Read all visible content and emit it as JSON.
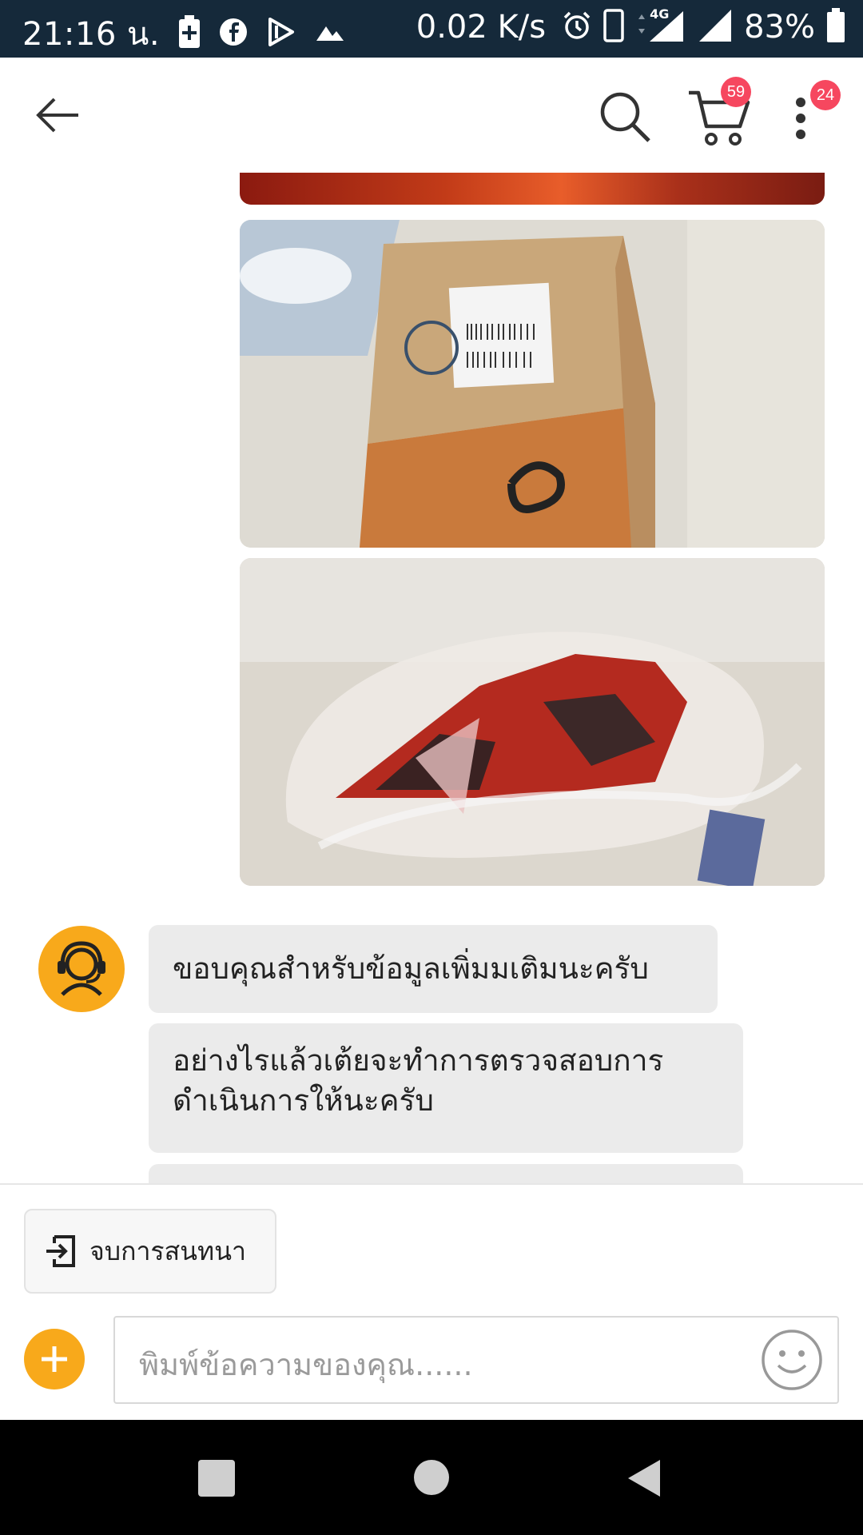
{
  "status_bar": {
    "time": "21:16 น.",
    "speed": "0.02 K/s",
    "network": "4G",
    "battery": "83%"
  },
  "app_bar": {
    "cart_count": "59",
    "more_count": "24",
    "icons": [
      "back-arrow-icon",
      "search-icon",
      "cart-icon",
      "more-vert-icon"
    ]
  },
  "messages": [
    {
      "text": "ขอบคุณสำหรับข้อมูลเพิ่มมเติมนะครับ"
    },
    {
      "text": "อย่างไรแล้วเต้ยจะทำการตรวจสอบการดำเนินการให้นะครับ"
    },
    {
      "text": ""
    }
  ],
  "composer": {
    "end_chat_label": "จบการสนทนา",
    "placeholder": "พิมพ์ข้อความของคุณ......"
  },
  "colors": {
    "accent": "#f8a91b",
    "badge": "#f6475f",
    "status_bar": "#15293a",
    "bubble": "#ebebeb"
  }
}
